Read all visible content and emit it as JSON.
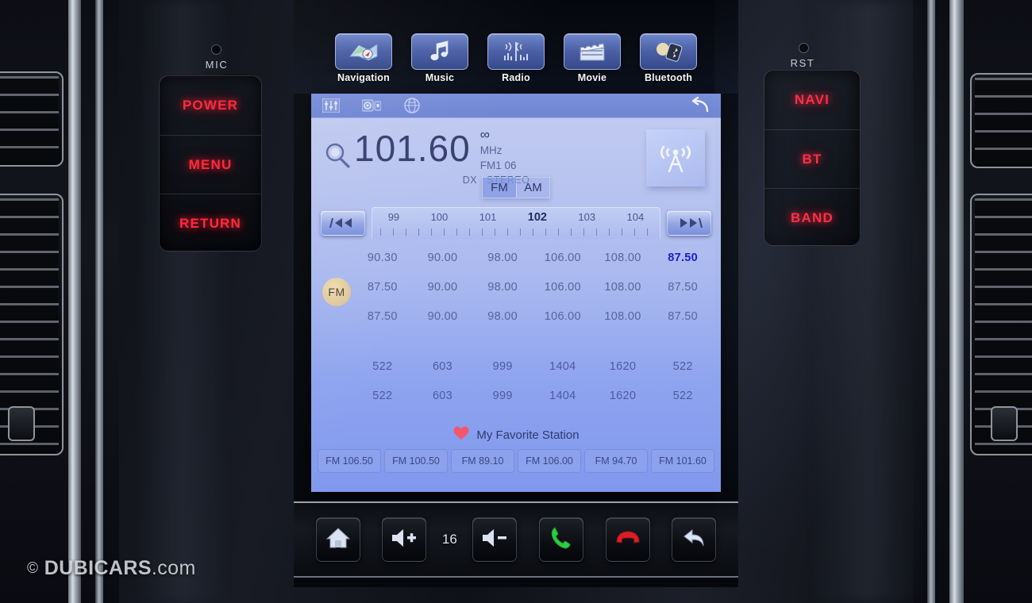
{
  "dashboard": {
    "left_cluster": {
      "mic_label": "MIC",
      "buttons": [
        "POWER",
        "MENU",
        "RETURN"
      ]
    },
    "right_cluster": {
      "rst_label": "RST",
      "buttons": [
        "NAVI",
        "BT",
        "BAND"
      ]
    }
  },
  "launcher": {
    "apps": [
      {
        "label": "Navigation",
        "icon": "map-icon"
      },
      {
        "label": "Music",
        "icon": "music-note-icon"
      },
      {
        "label": "Radio",
        "icon": "radio-wave-icon"
      },
      {
        "label": "Movie",
        "icon": "film-clapper-icon"
      },
      {
        "label": "Bluetooth",
        "icon": "bluetooth-device-icon"
      }
    ]
  },
  "radio": {
    "topbar": {
      "icons": [
        "equalizer-icon",
        "camera-icon",
        "globe-icon"
      ],
      "back_icon": "back-arrow-icon"
    },
    "frequency": {
      "search_icon": "magnifier-icon",
      "value": "101.60",
      "signal": "∞",
      "unit": "MHz",
      "band_preset": "FM1  06",
      "mode_dx": "DX",
      "mode_stereo": "STEREO",
      "tower_icon": "radio-tower-icon"
    },
    "band_toggle": {
      "options": [
        "FM",
        "AM"
      ],
      "selected": "FM"
    },
    "tuning": {
      "seek_down_icon": "seek-backward-icon",
      "seek_up_icon": "seek-forward-icon",
      "ticks": [
        "99",
        "100",
        "101",
        "102",
        "103",
        "104"
      ],
      "current_tick": "102"
    },
    "fm": {
      "badge": "FM",
      "rows": [
        [
          "90.30",
          "90.00",
          "98.00",
          "106.00",
          "108.00",
          "87.50"
        ],
        [
          "87.50",
          "90.00",
          "98.00",
          "106.00",
          "108.00",
          "87.50"
        ],
        [
          "87.50",
          "90.00",
          "98.00",
          "106.00",
          "108.00",
          "87.50"
        ]
      ],
      "highlight": {
        "row": 0,
        "col": 5
      },
      "highlight_color": "#1a1ec8"
    },
    "am": {
      "rows": [
        [
          "522",
          "603",
          "999",
          "1404",
          "1620",
          "522"
        ],
        [
          "522",
          "603",
          "999",
          "1404",
          "1620",
          "522"
        ]
      ]
    },
    "favorites": {
      "heart_icon": "heart-icon",
      "title": "My Favorite Station",
      "stations": [
        "FM 106.50",
        "FM 100.50",
        "FM 89.10",
        "FM 106.00",
        "FM 94.70",
        "FM 101.60"
      ]
    }
  },
  "bottom_bar": {
    "home_icon": "home-icon",
    "volume_up_icon": "volume-up-icon",
    "volume_level": "16",
    "volume_down_icon": "volume-down-icon",
    "call_answer_icon": "phone-answer-icon",
    "call_end_icon": "phone-hangup-icon",
    "back_icon": "back-arrow-icon"
  },
  "watermark": {
    "copyright": "©",
    "brand": "DUBICARS",
    "tld": ".com"
  },
  "colors": {
    "hardware_red": "#ff2a3c",
    "screen_blue": "#8fa4ef",
    "accent_blue": "#1a1ec8",
    "call_green": "#2ecc40",
    "call_red": "#d81f26"
  }
}
